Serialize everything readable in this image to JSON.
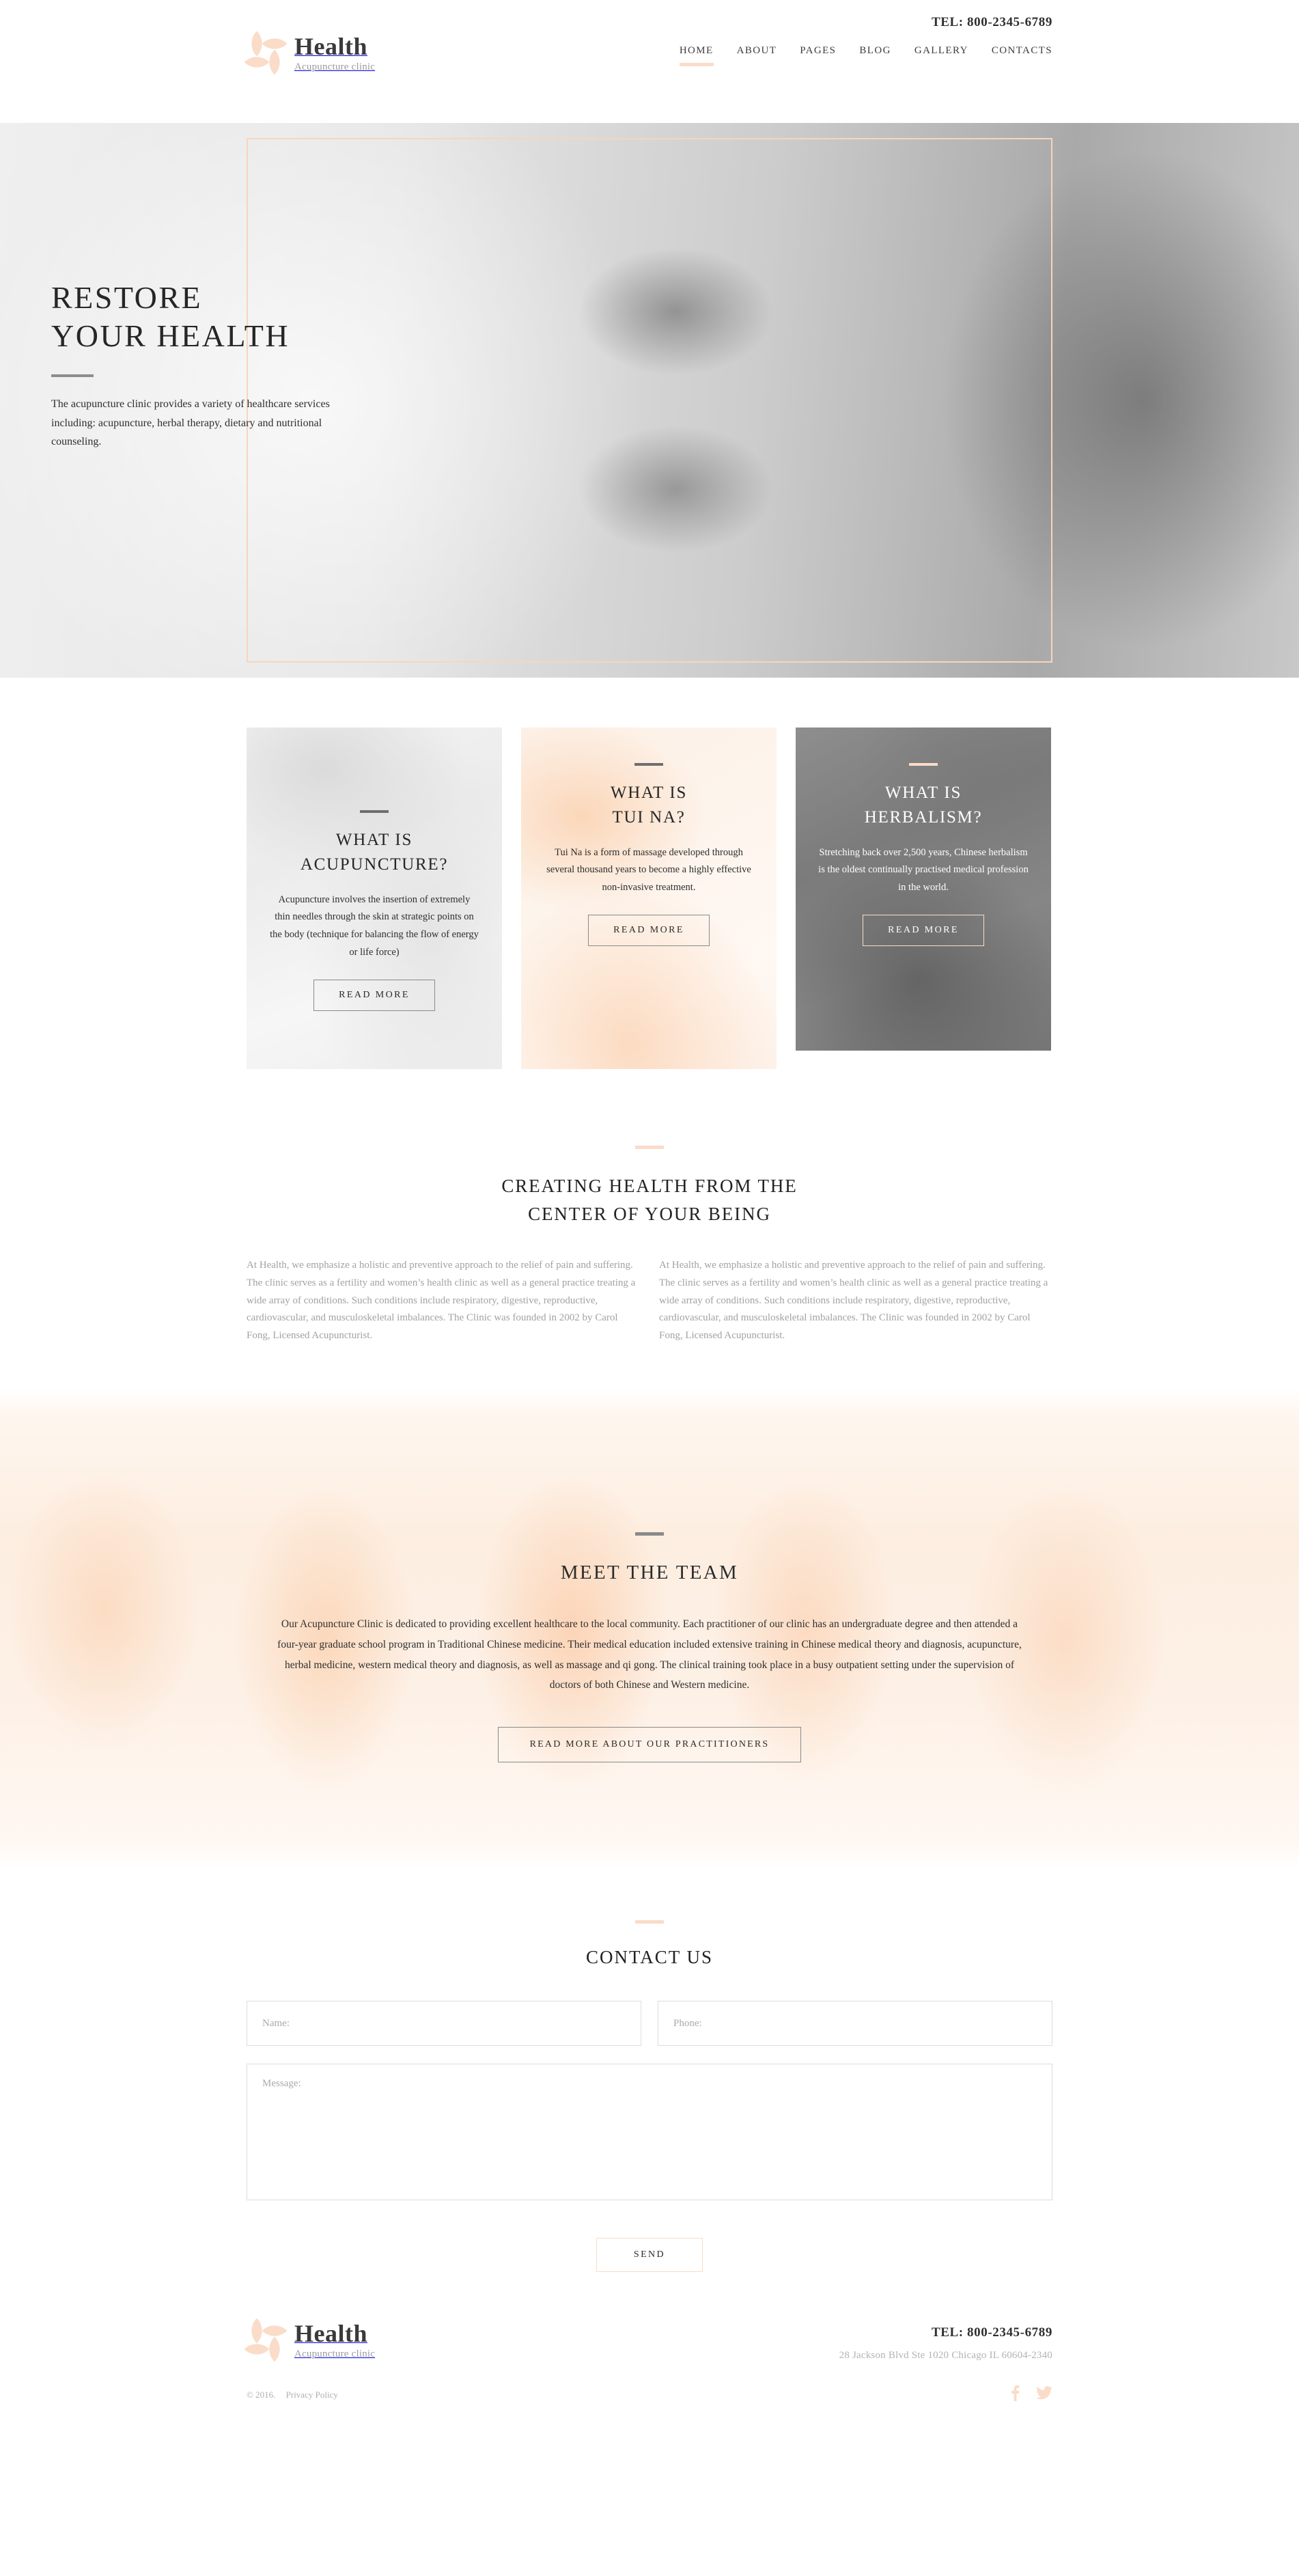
{
  "brand": {
    "name": "Health",
    "tagline": "Acupuncture clinic",
    "logo_icon": "flower-petal-logo",
    "accent_color": "#fadcc8"
  },
  "header": {
    "tel": "TEL: 800-2345-6789",
    "nav": [
      {
        "label": "HOME",
        "active": true
      },
      {
        "label": "ABOUT",
        "active": false
      },
      {
        "label": "PAGES",
        "active": false
      },
      {
        "label": "BLOG",
        "active": false
      },
      {
        "label": "GALLERY",
        "active": false
      },
      {
        "label": "CONTACTS",
        "active": false
      }
    ]
  },
  "hero": {
    "title_line1": "RESTORE",
    "title_line2": "YOUR HEALTH",
    "description": "The acupuncture clinic provides a variety of healthcare services including: acupuncture, herbal therapy, dietary and nutritional counseling."
  },
  "cards": [
    {
      "title_line1": "WHAT IS",
      "title_line2": "ACUPUNCTURE?",
      "text": "Acupuncture involves the insertion of extremely thin needles through the skin at strategic points on the body (technique for balancing the flow of energy or life force)",
      "button": "READ MORE"
    },
    {
      "title_line1": "WHAT IS",
      "title_line2": "TUI NA?",
      "text": "Tui Na is a form of massage developed through several thousand years to become a highly effective non-invasive treatment.",
      "button": "READ MORE"
    },
    {
      "title_line1": "WHAT IS",
      "title_line2": "HERBALISM?",
      "text": "Stretching back over 2,500 years, Chinese herbalism is the oldest continually practised medical profession in the world.",
      "button": "READ MORE"
    }
  ],
  "about": {
    "title_line1": "CREATING HEALTH FROM THE",
    "title_line2": "CENTER OF YOUR BEING",
    "column_left": "At Health, we emphasize a holistic and preventive approach to the relief of pain and suffering. The clinic serves as a fertility and women’s health clinic as well as a general practice treating a wide array of conditions. Such conditions include respiratory, digestive, reproductive, cardiovascular, and musculoskeletal imbalances. The Clinic was founded in 2002 by Carol Fong, Licensed Acupuncturist.",
    "column_right": "At Health, we emphasize a holistic and preventive approach to the relief of pain and suffering. The clinic serves as a fertility and women’s health clinic as well as a general practice treating a wide array of conditions. Such conditions include respiratory, digestive, reproductive, cardiovascular, and musculoskeletal imbalances. The Clinic was founded in 2002 by Carol Fong, Licensed Acupuncturist."
  },
  "team": {
    "title": "MEET THE TEAM",
    "text": "Our Acupuncture Clinic is dedicated to providing excellent healthcare to the local community. Each practitioner of our clinic has an undergraduate degree and then attended a four-year graduate school program in Traditional Chinese medicine. Their medical education included extensive training in Chinese medical theory and diagnosis, acupuncture, herbal medicine, western medical theory and diagnosis, as well as massage and qi gong. The clinical training took place in a busy outpatient setting under the supervision of doctors of both Chinese and Western medicine.",
    "button": "READ MORE ABOUT OUR PRACTITIONERS"
  },
  "contact": {
    "title": "CONTACT US",
    "name_placeholder": "Name:",
    "name_value": "",
    "phone_placeholder": "Phone:",
    "phone_value": "",
    "message_placeholder": "Message:",
    "message_value": "",
    "send_button": "SEND"
  },
  "footer": {
    "tel": "TEL: 800-2345-6789",
    "address": "28 Jackson Blvd Ste 1020 Chicago IL 60604-2340",
    "copyright": "© 2016.",
    "privacy": "Privacy Policy",
    "socials": [
      {
        "name": "facebook-icon"
      },
      {
        "name": "twitter-icon"
      }
    ]
  }
}
